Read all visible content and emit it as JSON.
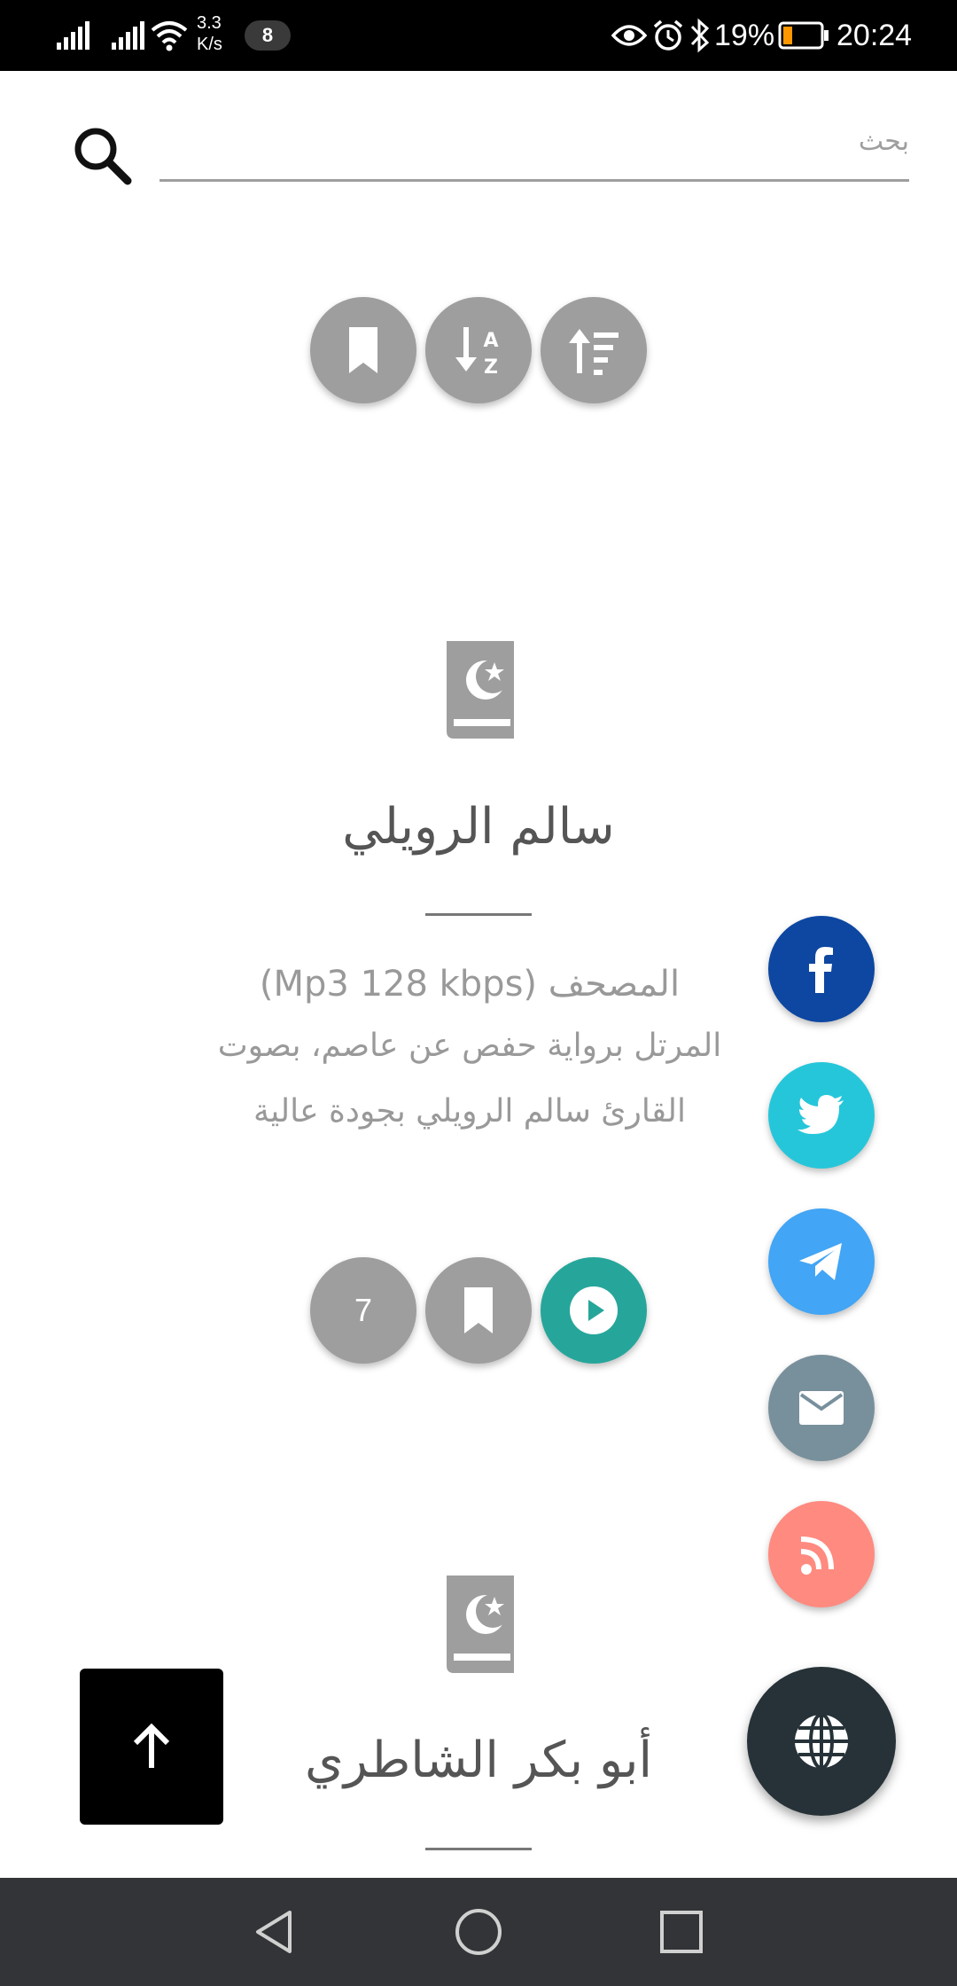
{
  "status_bar": {
    "network_speed_value": "3.3",
    "network_speed_unit": "K/s",
    "notification_count": "8",
    "battery_percent": "19%",
    "time": "20:24"
  },
  "search": {
    "placeholder": "بحث"
  },
  "toolbar": {
    "icons": [
      "bookmark-icon",
      "sort-alpha-icon",
      "sort-amount-icon"
    ]
  },
  "reciters": [
    {
      "name": "سالم الرويلي",
      "description_title": "المصحف (Mp3 128 kbps)",
      "description_line1": "المرتل برواية حفص عن عاصم، بصوت",
      "description_line2": "القارئ سالم الرويلي بجودة عالية",
      "count": "7"
    },
    {
      "name": "أبو بكر الشاطري"
    }
  ],
  "social": [
    "facebook-icon",
    "twitter-icon",
    "telegram-icon",
    "mail-icon",
    "rss-icon"
  ],
  "colors": {
    "grey_button": "#9e9e9e",
    "play_button": "#26a69a",
    "facebook": "#0d47a1",
    "twitter": "#26c6da",
    "telegram": "#42a5f5",
    "mail": "#78909c",
    "rss": "#ff8a80",
    "globe_fab": "#263238"
  }
}
